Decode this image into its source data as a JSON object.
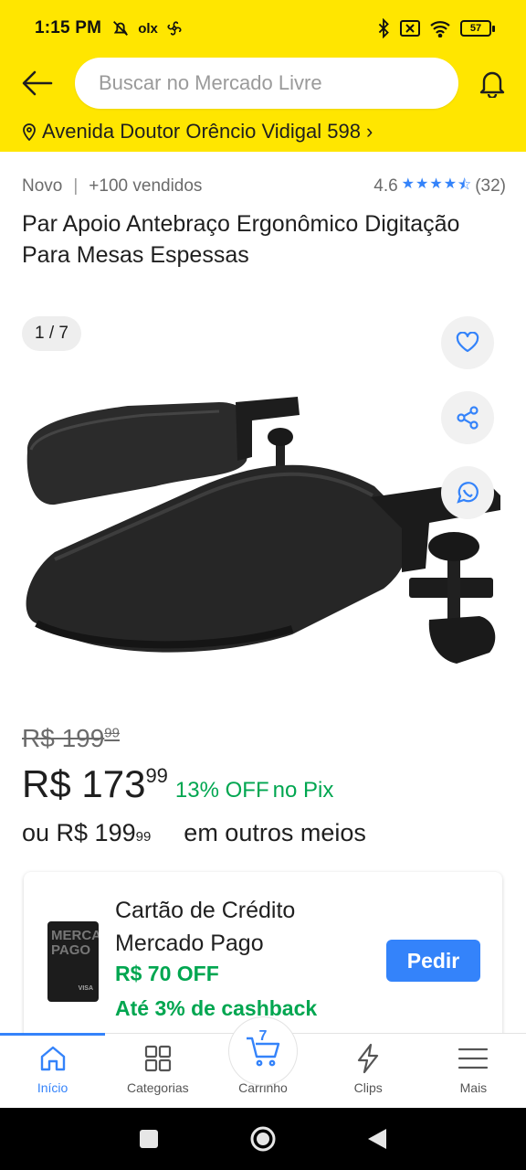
{
  "status_bar": {
    "time": "1:15 PM",
    "left_icons": [
      "mute-icon",
      "olx-icon",
      "fan-icon"
    ],
    "olx_label": "olx",
    "right_icons": [
      "bluetooth-icon",
      "sim-icon",
      "wifi-icon",
      "battery-icon"
    ],
    "battery": "57"
  },
  "header": {
    "search_placeholder": "Buscar no Mercado Livre",
    "address": "Avenida Doutor Orêncio Vidigal 598",
    "address_chevron": "›",
    "colors": {
      "background": "#ffe600"
    }
  },
  "product": {
    "condition": "Novo",
    "separator": "|",
    "sold": "+100 vendidos",
    "rating": "4.6",
    "stars": 4.6,
    "reviews": "(32)",
    "title": "Par Apoio Antebraço Ergonômico Digitação Para Mesas Espessas",
    "image_counter": "1 / 7",
    "image_icon": "armrest-product-image"
  },
  "gallery_actions": [
    "favorite-icon",
    "share-icon",
    "whatsapp-share-icon"
  ],
  "pricing": {
    "old_price": "R$ 199",
    "old_cents": "99",
    "price": "R$ 173",
    "price_cents": "99",
    "discount": "13% OFF",
    "discount_method": "no Pix",
    "installment_prefix": "ou R$ 199",
    "installment_cents": "99",
    "installment_suffix": "em outros meios",
    "colors": {
      "green": "#00a650"
    }
  },
  "promo": {
    "title": "Cartão de Crédito Mercado Pago",
    "card_text": "MERCADO PAGO",
    "card_brand": "VISA",
    "off": "R$ 70 OFF",
    "cashback": "Até 3% de cashback",
    "button": "Pedir",
    "colors": {
      "button": "#3483fa"
    }
  },
  "bottom_nav": {
    "items": [
      {
        "label": "Início",
        "icon": "home-icon",
        "active": true
      },
      {
        "label": "Categorias",
        "icon": "grid-icon",
        "active": false
      },
      {
        "label": "Carrinho",
        "icon": "cart-icon",
        "active": false,
        "count": "7"
      },
      {
        "label": "Clips",
        "icon": "clips-icon",
        "active": false
      },
      {
        "label": "Mais",
        "icon": "menu-icon",
        "active": false
      }
    ],
    "colors": {
      "active": "#3483fa"
    }
  },
  "android_nav": [
    "recents-button",
    "home-button",
    "back-button"
  ]
}
